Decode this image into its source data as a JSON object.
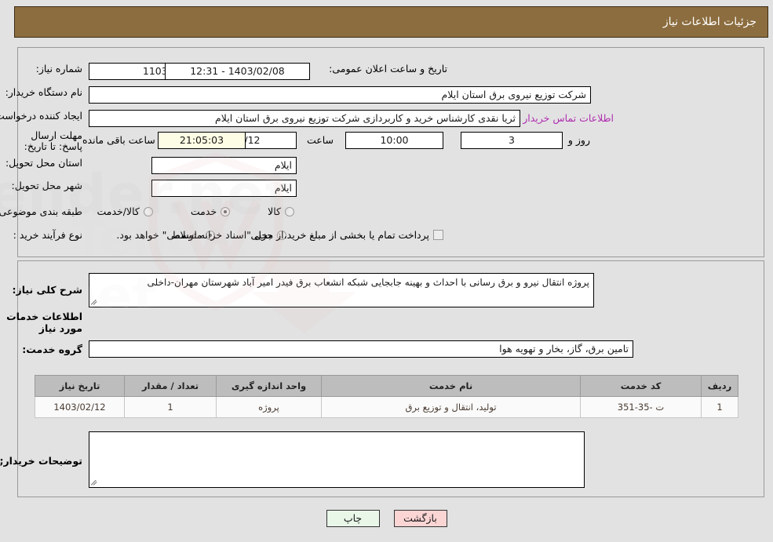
{
  "header": {
    "title": "جزئیات اطلاعات نیاز"
  },
  "form": {
    "need_number_label": "شماره نیاز:",
    "need_number_value": "1103001427000013",
    "announce_datetime_label": "تاریخ و ساعت اعلان عمومی:",
    "announce_datetime_value": "1403/02/08 - 12:31",
    "buyer_org_label": "نام دستگاه خریدار:",
    "buyer_org_value": "شرکت توزیع نیروی برق استان ایلام",
    "creator_label": "ایجاد کننده درخواست:",
    "creator_value": "ثریا نقدی کارشناس خرید و کاربردازی شرکت توزیع نیروی برق استان ایلام",
    "contact_link": "اطلاعات تماس خریدار",
    "deadline_label": "مهلت ارسال پاسخ: تا تاریخ:",
    "deadline_date": "1403/02/12",
    "deadline_hour_label": "ساعت",
    "deadline_hour_value": "10:00",
    "remaining_days": "3",
    "remaining_days_label": "روز و",
    "remaining_time": "21:05:03",
    "remaining_time_label": "ساعت باقی مانده",
    "province_label": "استان محل تحویل:",
    "province_value": "ایلام",
    "city_label": "شهر محل تحویل:",
    "city_value": "ایلام",
    "category_label": "طبقه بندی موضوعی:",
    "category_options": [
      {
        "label": "کالا",
        "selected": false
      },
      {
        "label": "خدمت",
        "selected": true
      },
      {
        "label": "کالا/خدمت",
        "selected": false
      }
    ],
    "process_label": "نوع فرآیند خرید :",
    "process_options": [
      {
        "label": "جزیی",
        "selected": false
      },
      {
        "label": "متوسط",
        "selected": true
      }
    ],
    "treasury_checkbox_text": "پرداخت تمام یا بخشی از مبلغ خرید،از محل \"اسناد خزانه اسلامی\" خواهد بود.",
    "treasury_checked": false
  },
  "description": {
    "label": "شرح کلی نیاز:",
    "value": "پروژه انتقال نیرو و برق رسانی با احداث و بهینه جابجایی شبکه انشعاب برق فیدر امیر آباد شهرستان مهران-داخلی"
  },
  "services": {
    "section_title": "اطلاعات خدمات مورد نیاز",
    "group_label": "گروه خدمت:",
    "group_value": "تامین برق، گاز، بخار و تهویه هوا",
    "columns": [
      "ردیف",
      "کد خدمت",
      "نام خدمت",
      "واحد اندازه گیری",
      "تعداد / مقدار",
      "تاریخ نیاز"
    ],
    "rows": [
      {
        "index": "1",
        "code": "ت -35-351",
        "name": "تولید، انتقال و توزیع برق",
        "unit": "پروژه",
        "quantity": "1",
        "date": "1403/02/12"
      }
    ]
  },
  "notes": {
    "label": "توضیحات خریدار;",
    "value": ""
  },
  "footer": {
    "print_label": "چاپ",
    "back_label": "بازگشت"
  },
  "colors": {
    "header_bg": "#8c6d3f",
    "page_bg": "#e2e2e2",
    "link": "#b02fb0",
    "highlight_field": "#fdfce4",
    "print_btn": "#e9f7e9",
    "back_btn": "#fbd4d4"
  }
}
